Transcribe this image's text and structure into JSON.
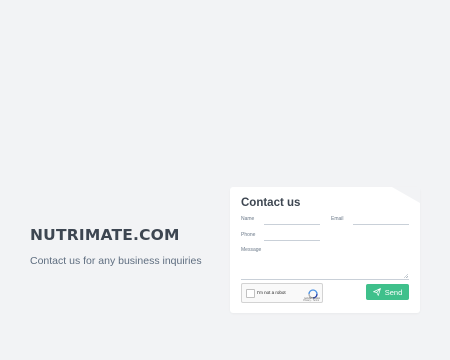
{
  "brand": {
    "title": "NUTRIMATE.COM",
    "subtitle": "Contact us for any business inquiries"
  },
  "contact_form": {
    "title": "Contact us",
    "fields": {
      "name_label": "Name",
      "email_label": "Email",
      "phone_label": "Phone",
      "message_label": "Message"
    },
    "recaptcha": {
      "label": "I'm not a robot",
      "brand": "reCAPTCHA",
      "links": "Privacy - Terms"
    },
    "send_label": "Send",
    "icons": {
      "send": "paper-plane-icon",
      "recaptcha": "recaptcha-logo-icon"
    },
    "colors": {
      "background": "#f2f3f5",
      "card": "#ffffff",
      "accent": "#3fc08b",
      "heading": "#3d4651"
    }
  }
}
